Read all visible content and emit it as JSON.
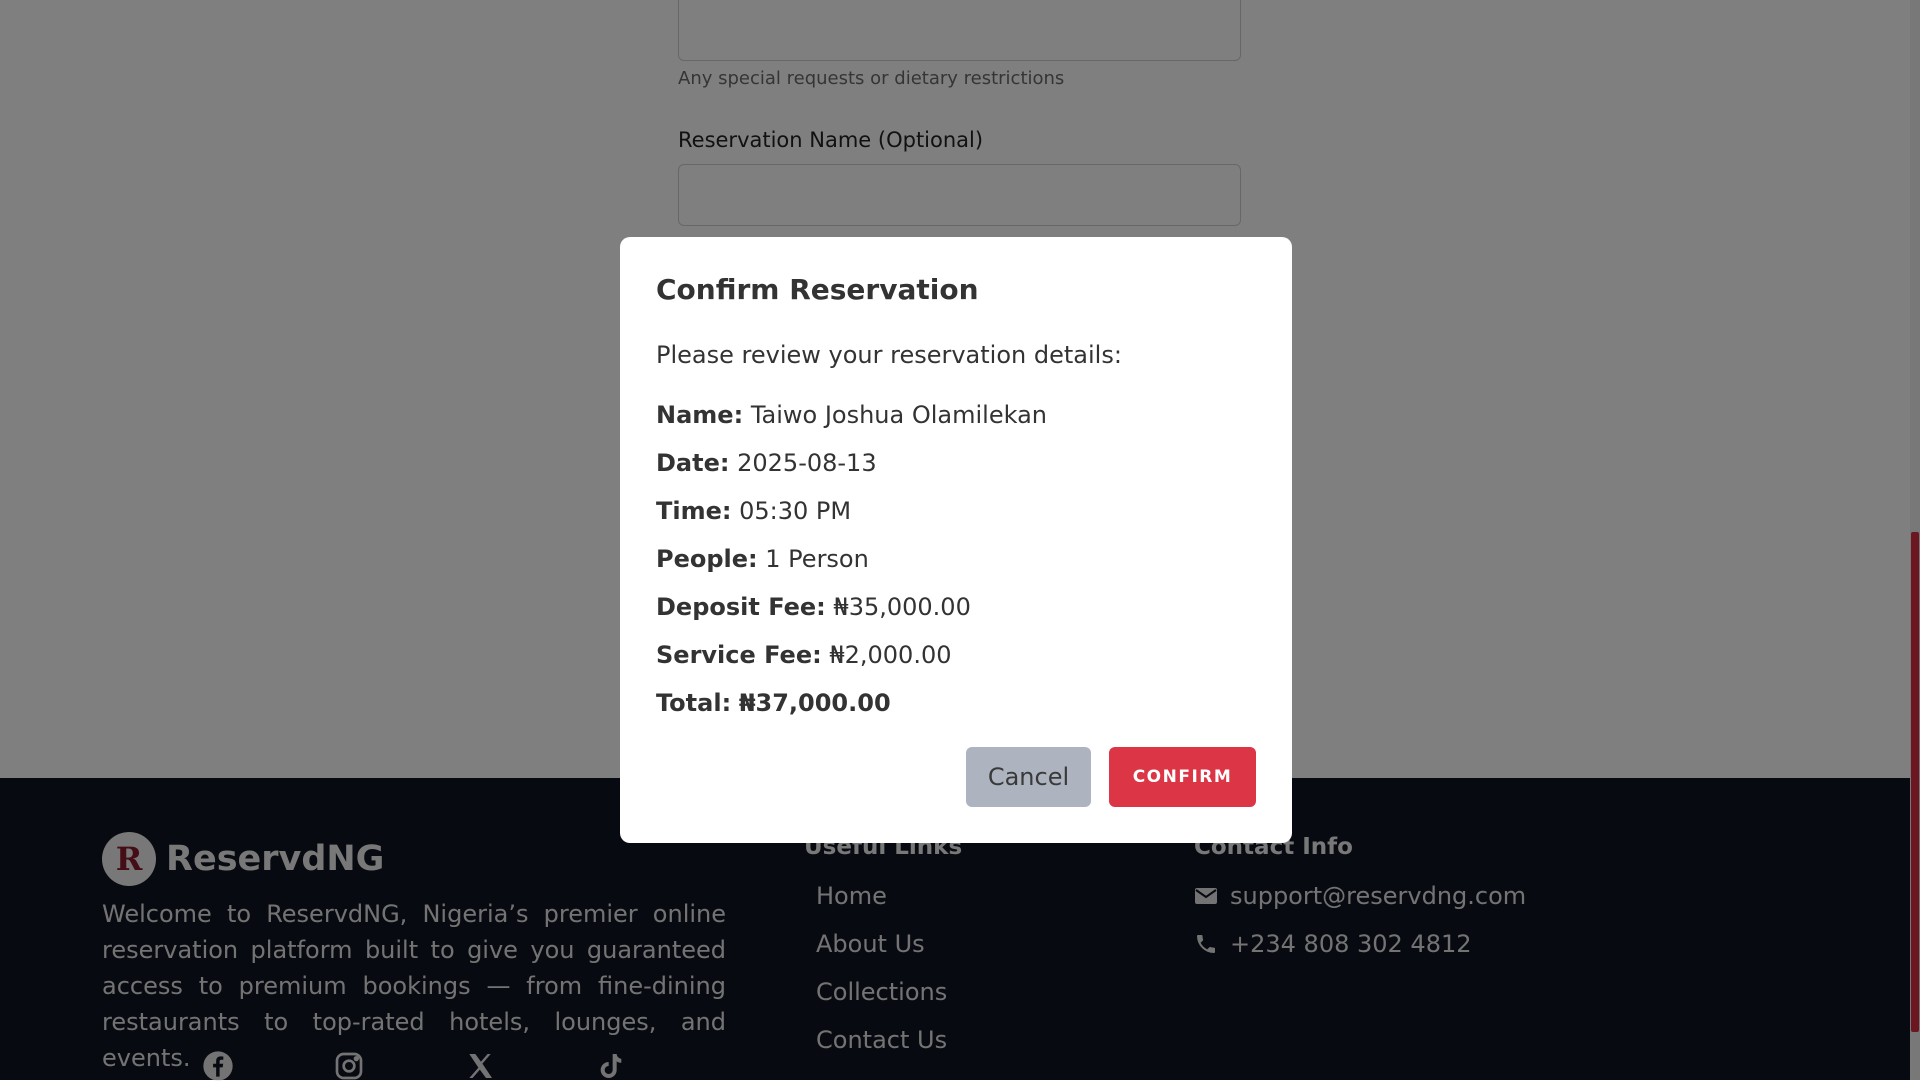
{
  "form": {
    "notes_hint": "Any special requests or dietary restrictions",
    "reservation_name_label": "Reservation Name (Optional)",
    "reservation_name_value": ""
  },
  "footer": {
    "brand_initial": "R",
    "brand_name": "ReservdNG",
    "about": "Welcome to ReservdNG, Nigeria’s premier online reservation platform built to give you guaranteed access to premium bookings — from fine-dining restaurants to top-rated hotels, lounges, and events.",
    "social_icons": [
      "facebook-icon",
      "instagram-icon",
      "x-icon",
      "tiktok-icon"
    ],
    "useful_links_title": "Useful Links",
    "links": [
      "Home",
      "About Us",
      "Collections",
      "Contact Us"
    ],
    "contact_title": "Contact Info",
    "email": "support@reservdng.com",
    "phone": "+234 808 302 4812"
  },
  "modal": {
    "title": "Confirm Reservation",
    "subtitle": "Please review your reservation details:",
    "details": [
      {
        "label": "Name:",
        "value": "Taiwo Joshua Olamilekan"
      },
      {
        "label": "Date:",
        "value": "2025-08-13"
      },
      {
        "label": "Time:",
        "value": "05:30 PM"
      },
      {
        "label": "People:",
        "value": "1 Person"
      },
      {
        "label": "Deposit Fee:",
        "value": "₦35,000.00"
      },
      {
        "label": "Service Fee:",
        "value": "₦2,000.00"
      },
      {
        "label": "Total:",
        "value": "₦37,000.00"
      }
    ],
    "cancel_label": "Cancel",
    "confirm_label": "CONFIRM"
  },
  "colors": {
    "accent": "#dc3545",
    "footer_bg": "#111522",
    "cancel_bg": "#adb4bf"
  }
}
